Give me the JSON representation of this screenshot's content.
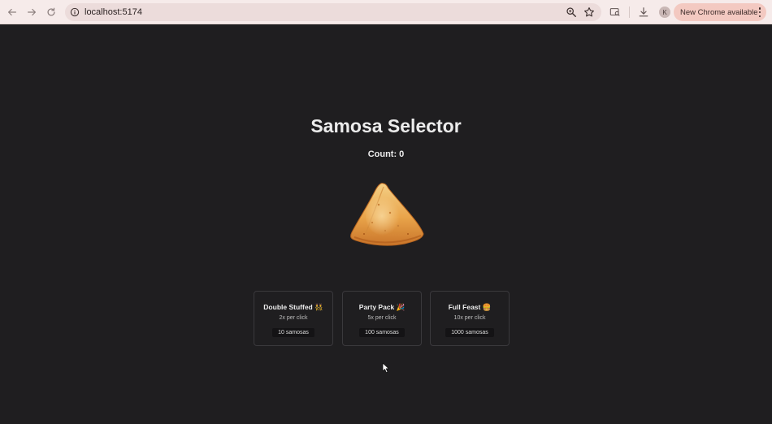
{
  "browser": {
    "url": "localhost:5174",
    "avatar_letter": "K",
    "update_label": "New Chrome available"
  },
  "app": {
    "title": "Samosa Selector",
    "count_label": "Count: 0",
    "upgrades": [
      {
        "name": "Double Stuffed 👯",
        "rate": "2x per click",
        "cost": "10 samosas"
      },
      {
        "name": "Party Pack 🎉",
        "rate": "5x per click",
        "cost": "100 samosas"
      },
      {
        "name": "Full Feast 🍔",
        "rate": "10x per click",
        "cost": "1000 samosas"
      }
    ]
  },
  "colors": {
    "page_background": "#1f1e20",
    "card_border": "#3a393c",
    "chrome_background": "#f6ebea",
    "update_pill": "#f3c9c1"
  }
}
